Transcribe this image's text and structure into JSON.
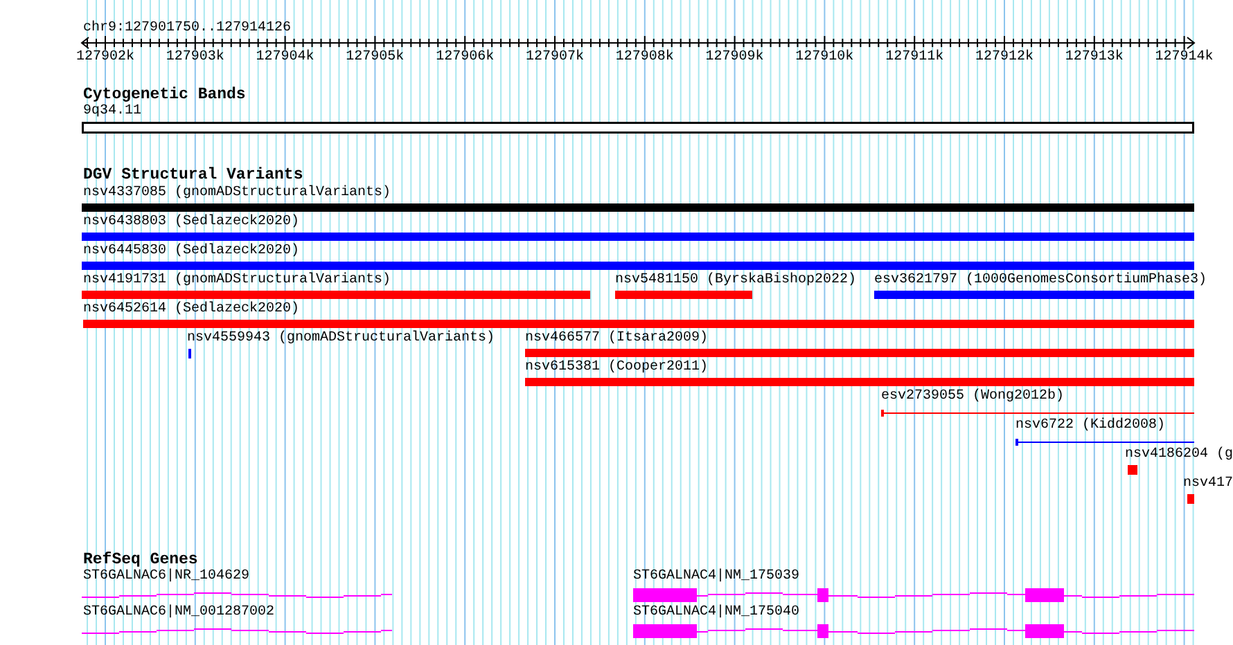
{
  "location": "chr9:127901750..127914126",
  "ruler": {
    "ticks": [
      "127902k",
      "127903k",
      "127904k",
      "127905k",
      "127906k",
      "127907k",
      "127908k",
      "127909k",
      "127910k",
      "127911k",
      "127912k",
      "127913k",
      "127914k"
    ]
  },
  "tracks": [
    {
      "kind": "bands",
      "title": "Cytogenetic Bands",
      "features": [
        {
          "label": "9q34.11"
        }
      ]
    },
    {
      "kind": "variants",
      "title": "DGV Structural Variants",
      "features": [
        {
          "label": "nsv4337085 (gnomADStructuralVariants)",
          "color": "#000000"
        },
        {
          "label": "nsv6438803 (Sedlazeck2020)",
          "color": "#0000ff"
        },
        {
          "label": "nsv6445830 (Sedlazeck2020)",
          "color": "#0000ff"
        },
        {
          "label": "nsv4191731 (gnomADStructuralVariants)",
          "color": "#ff0000"
        },
        {
          "label": "nsv5481150 (ByrskaBishop2022)",
          "color": "#ff0000"
        },
        {
          "label": "esv3621797 (1000GenomesConsortiumPhase3)",
          "color": "#0000ff"
        },
        {
          "label": "nsv6452614 (Sedlazeck2020)",
          "color": "#ff0000"
        },
        {
          "label": "nsv4559943 (gnomADStructuralVariants)",
          "color": "#0000ff"
        },
        {
          "label": "nsv466577 (Itsara2009)",
          "color": "#ff0000"
        },
        {
          "label": "nsv615381 (Cooper2011)",
          "color": "#ff0000"
        },
        {
          "label": "esv2739055 (Wong2012b)",
          "color": "#ff0000"
        },
        {
          "label": "nsv6722 (Kidd2008)",
          "color": "#0000ff"
        },
        {
          "label": "nsv4186204 (g",
          "color": "#ff0000"
        },
        {
          "label": "nsv417",
          "color": "#ff0000"
        }
      ]
    },
    {
      "kind": "genes",
      "title": "RefSeq Genes",
      "features": [
        {
          "label": "ST6GALNAC6|NR_104629"
        },
        {
          "label": "ST6GALNAC6|NM_001287002"
        },
        {
          "label": "ST6GALNAC4|NM_175039"
        },
        {
          "label": "ST6GALNAC4|NM_175040"
        }
      ]
    }
  ]
}
